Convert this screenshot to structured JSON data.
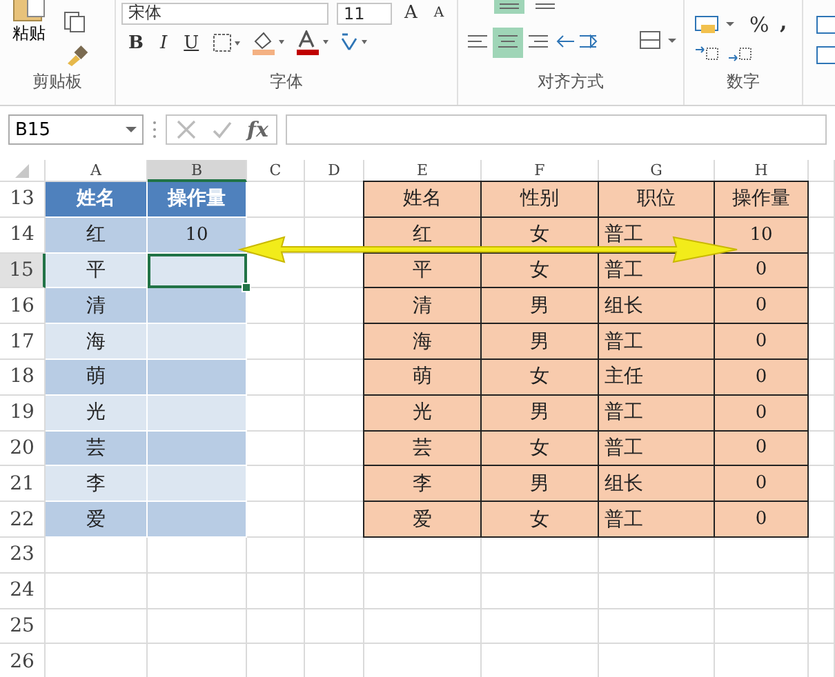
{
  "ribbon": {
    "groups": [
      {
        "kind": "clipboard",
        "label": "剪贴板",
        "paste": "粘贴"
      },
      {
        "kind": "font",
        "label": "字体",
        "font_name": "宋体",
        "font_size": "11",
        "bold": "B",
        "italic": "I",
        "underline": "U",
        "grow": "A",
        "shrink": "A"
      },
      {
        "kind": "alignment",
        "label": "对齐方式"
      },
      {
        "kind": "number",
        "label": "数字",
        "percent": "%",
        "comma": ","
      }
    ]
  },
  "formula_bar": {
    "name_box": "B15",
    "fx": "fx"
  },
  "sheet": {
    "columns": [
      {
        "label": "A",
        "selected": false
      },
      {
        "label": "B",
        "selected": true
      },
      {
        "label": "C",
        "selected": false
      },
      {
        "label": "D",
        "selected": false
      },
      {
        "label": "E",
        "selected": false
      },
      {
        "label": "F",
        "selected": false
      },
      {
        "label": "G",
        "selected": false
      },
      {
        "label": "H",
        "selected": false
      }
    ],
    "rows": [
      {
        "number": "13",
        "selected": false
      },
      {
        "number": "14",
        "selected": false
      },
      {
        "number": "15",
        "selected": true
      },
      {
        "number": "16",
        "selected": false
      },
      {
        "number": "17",
        "selected": false
      },
      {
        "number": "18",
        "selected": false
      },
      {
        "number": "19",
        "selected": false
      },
      {
        "number": "20",
        "selected": false
      },
      {
        "number": "21",
        "selected": false
      },
      {
        "number": "22",
        "selected": false
      },
      {
        "number": "23",
        "selected": false
      },
      {
        "number": "24",
        "selected": false
      },
      {
        "number": "25",
        "selected": false
      },
      {
        "number": "26",
        "selected": false
      }
    ],
    "left_table": {
      "header": [
        "姓名",
        "操作量"
      ],
      "rows": [
        [
          "红",
          "10"
        ],
        [
          "平",
          ""
        ],
        [
          "清",
          ""
        ],
        [
          "海",
          ""
        ],
        [
          "萌",
          ""
        ],
        [
          "光",
          ""
        ],
        [
          "芸",
          ""
        ],
        [
          "李",
          ""
        ],
        [
          "爱",
          ""
        ]
      ]
    },
    "right_table": {
      "header": [
        "姓名",
        "性别",
        "职位",
        "操作量"
      ],
      "rows": [
        [
          "红",
          "女",
          "普工",
          "10"
        ],
        [
          "平",
          "女",
          "普工",
          "0"
        ],
        [
          "清",
          "男",
          "组长",
          "0"
        ],
        [
          "海",
          "男",
          "普工",
          "0"
        ],
        [
          "萌",
          "女",
          "主任",
          "0"
        ],
        [
          "光",
          "男",
          "普工",
          "0"
        ],
        [
          "芸",
          "女",
          "普工",
          "0"
        ],
        [
          "李",
          "男",
          "组长",
          "0"
        ],
        [
          "爱",
          "女",
          "普工",
          "0"
        ]
      ]
    }
  }
}
